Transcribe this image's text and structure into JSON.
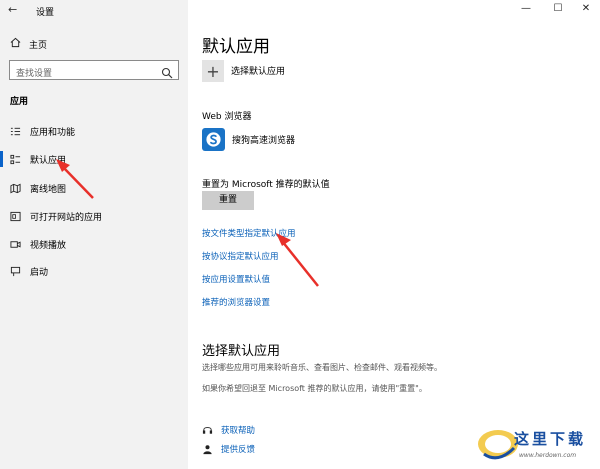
{
  "window": {
    "title": "设置",
    "back_glyph": "←",
    "minimize_glyph": "—",
    "maximize_glyph": "☐",
    "close_glyph": "✕"
  },
  "sidebar": {
    "home_label": "主页",
    "search_placeholder": "查找设置",
    "section_label": "应用",
    "items": [
      {
        "label": "应用和功能",
        "icon": "apps-list-icon"
      },
      {
        "label": "默认应用",
        "icon": "default-apps-icon",
        "active": true
      },
      {
        "label": "离线地图",
        "icon": "offline-map-icon"
      },
      {
        "label": "可打开网站的应用",
        "icon": "website-apps-icon"
      },
      {
        "label": "视频播放",
        "icon": "video-playback-icon"
      },
      {
        "label": "启动",
        "icon": "startup-icon"
      }
    ]
  },
  "main": {
    "title": "默认应用",
    "choose_app_label": "选择默认应用",
    "web_browser_heading": "Web 浏览器",
    "browser_name": "搜狗高速浏览器",
    "reset_heading": "重置为 Microsoft 推荐的默认值",
    "reset_button": "重置",
    "links": [
      "按文件类型指定默认应用",
      "按协议指定默认应用",
      "按应用设置默认值",
      "推荐的浏览器设置"
    ],
    "section2_title": "选择默认应用",
    "section2_desc1": "选择哪些应用可用来聆听音乐、查看图片、检查邮件、观看视频等。",
    "section2_desc2": "如果你希望回退至 Microsoft 推荐的默认应用，请使用\"重置\"。",
    "help_links": [
      "获取帮助",
      "提供反馈"
    ]
  },
  "watermark": {
    "text": "这里下载",
    "url": "www.herdown.com"
  },
  "colors": {
    "accent": "#0a63c9",
    "link": "#0b61b8",
    "sidebar_bg": "#f2f2f2",
    "arrow": "#e8302a"
  }
}
